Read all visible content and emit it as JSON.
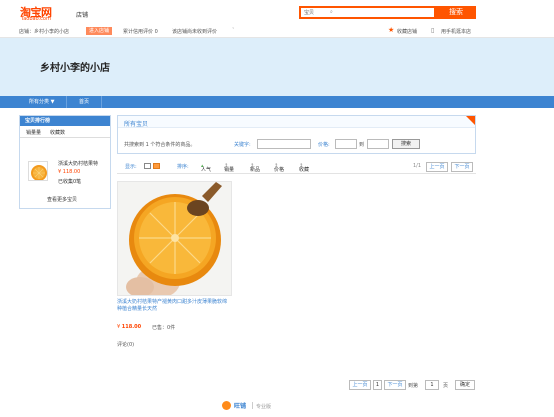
{
  "header": {
    "logo_cn": "淘宝网",
    "logo_en": "Taobao.com",
    "shop_word": "店铺",
    "search_scope": "宝贝",
    "search_button": "搜索"
  },
  "info_bar": {
    "shop_label": "店铺：乡村小李的小店",
    "tag": "进入店铺",
    "score": "累计信用评价 0",
    "rating": "该店铺尚未收到评价",
    "favorite": "收藏店铺",
    "mobile": "用手机逛本店"
  },
  "banner": {
    "shop_name": "乡村小李的小店"
  },
  "nav": {
    "category": "所有分类",
    "home": "首页"
  },
  "ranking": {
    "title": "宝贝排行榜",
    "tab_sales": "销量量",
    "tab_fav": "收藏数",
    "item_title": "浙溪大奶村桔果特",
    "item_price": "¥ 118.00",
    "item_sold": "已收集0笔",
    "more": "查看更多宝贝"
  },
  "all_items": {
    "title": "所有宝贝",
    "result": "共搜索到 1 个符合条件的商品。",
    "keyword_label": "关键字:",
    "price_label": "价格:",
    "to_label": "到",
    "search_button": "搜索"
  },
  "sort_bar": {
    "display": "显示:",
    "sort_label": "排序:",
    "popularity": "人气",
    "sales": "销量",
    "newest": "新品",
    "price": "价格",
    "favorites": "收藏",
    "page_info": "1/1",
    "prev": "上一页",
    "next": "下一页"
  },
  "product": {
    "title": "浙溪大奶村桔果特产褪黄肉口甜多汁皮薄果脆软绵种植合精量长天然",
    "price": "118.00",
    "currency": "¥",
    "sold": "已售：0件",
    "reviews": "评论(0)"
  },
  "pager": {
    "prev": "上一页",
    "current": "1",
    "next": "下一页",
    "goto": "到第",
    "page_value": "1",
    "page_unit": "页",
    "confirm": "确定"
  },
  "footer": {
    "wangwang": "旺铺",
    "edition": "专业版"
  },
  "colors": {
    "accent": "#ff5500",
    "nav_blue": "#3d84d1",
    "banner": "#ddeefa",
    "price": "#ff4400"
  }
}
